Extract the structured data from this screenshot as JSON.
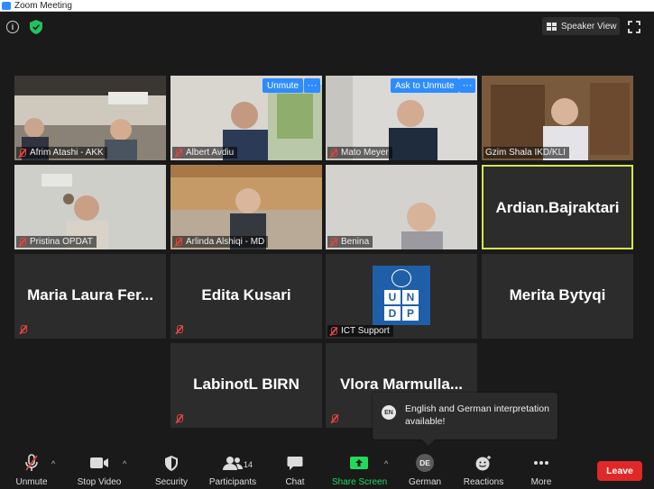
{
  "window": {
    "title": "Zoom Meeting"
  },
  "topbar": {
    "speaker_view_label": "Speaker View"
  },
  "tiles": [
    {
      "name": "Afrim Atashi - AKK"
    },
    {
      "name": "Albert Avdiu",
      "overlay_button": "Unmute",
      "overlay_more": "···"
    },
    {
      "name": "Mato Meyer",
      "overlay_button": "Ask to Unmute",
      "overlay_more": "···"
    },
    {
      "name": "Gzim Shala IKD/KLI"
    },
    {
      "name": "Pristina OPDAT"
    },
    {
      "name": "Arlinda Alshiqi - MD"
    },
    {
      "name": "Benina"
    },
    {
      "big_name": "Ardian.Bajraktari"
    },
    {
      "big_name": "Maria  Laura  Fer..."
    },
    {
      "big_name": "Edita Kusari"
    },
    {
      "name": "ICT Support",
      "logo_text": [
        "U",
        "N",
        "D",
        "P"
      ]
    },
    {
      "big_name": "Merita Bytyqi"
    },
    {
      "big_name": "LabinotL BIRN"
    },
    {
      "big_name": "Vlora  Marmulla..."
    }
  ],
  "tooltip": {
    "badge": "EN",
    "text": "English and German interpretation available!"
  },
  "toolbar": {
    "unmute": "Unmute",
    "stop_video": "Stop Video",
    "security": "Security",
    "participants": "Participants",
    "participants_count": "14",
    "chat": "Chat",
    "share_screen": "Share Screen",
    "language_badge": "DE",
    "language": "German",
    "reactions": "Reactions",
    "more": "More",
    "leave": "Leave"
  },
  "colors": {
    "accent": "#2d8cff",
    "share": "#23d959",
    "leave": "#e02828",
    "active_speaker": "#d7e84a"
  }
}
